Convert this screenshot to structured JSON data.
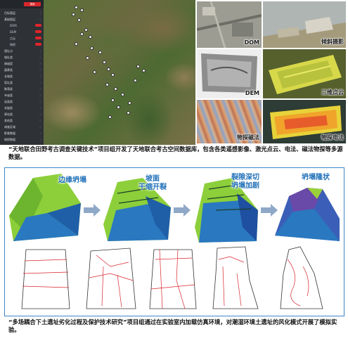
{
  "app": {
    "search_label": "搜索",
    "sidebar_items": [
      {
        "label": "目标图层",
        "sub": false
      },
      {
        "label": "基础图层",
        "sub": false
      },
      {
        "label": "DOM",
        "sub": true
      },
      {
        "label": "DEM",
        "sub": true
      },
      {
        "label": "点云",
        "sub": true
      },
      {
        "label": "物探",
        "sub": true
      },
      {
        "label": "遗址点",
        "sub": false
      },
      {
        "label": "城址类",
        "sub": false
      },
      {
        "label": "烽燧类",
        "sub": false
      },
      {
        "label": "墓葬类",
        "sub": false
      },
      {
        "label": "长城类",
        "sub": false
      },
      {
        "label": "窑址类",
        "sub": false
      },
      {
        "label": "聚落类",
        "sub": false
      },
      {
        "label": "寺庙类",
        "sub": false
      },
      {
        "label": "岩画类",
        "sub": false
      },
      {
        "label": "关隘类",
        "sub": false
      },
      {
        "label": "驿站类",
        "sub": false
      },
      {
        "label": "其他类",
        "sub": false
      },
      {
        "label": "调查区域",
        "sub": false
      },
      {
        "label": "影像数据",
        "sub": false
      },
      {
        "label": "物探数据",
        "sub": false
      }
    ]
  },
  "tiles": {
    "dom": "DOM",
    "tilt": "倾斜摄影",
    "dem": "DEM",
    "pointcloud": "三维点云",
    "geomag": "物探磁法",
    "electric": "物探电法"
  },
  "stages": [
    "边缘坍塌",
    "坡面\n干缩开裂",
    "裂隙深切\n坍塌加剧",
    "坍塌隆状"
  ],
  "captions": {
    "top": "“天地联合田野考古调查关键技术”项目组开发了天地联合考古空间数据库，包含各类遥感影像、激光点云、电法、磁法物探等多源数据。",
    "bottom": "“多场耦合下土遗址劣化过程及保护技术研究”项目组通过在实验室内加载仿真环境，对潮湿环境土遗址的风化模式开展了模拟实验。"
  },
  "colors": {
    "accent": "#1e6fb8",
    "panel_border": "#3b86c7",
    "sidebar": "#2e3135",
    "search_button": "#d9262c",
    "crack_lines": "#d9242b",
    "model_green": "#8ccf3a",
    "model_blue": "#1f5fa8"
  }
}
